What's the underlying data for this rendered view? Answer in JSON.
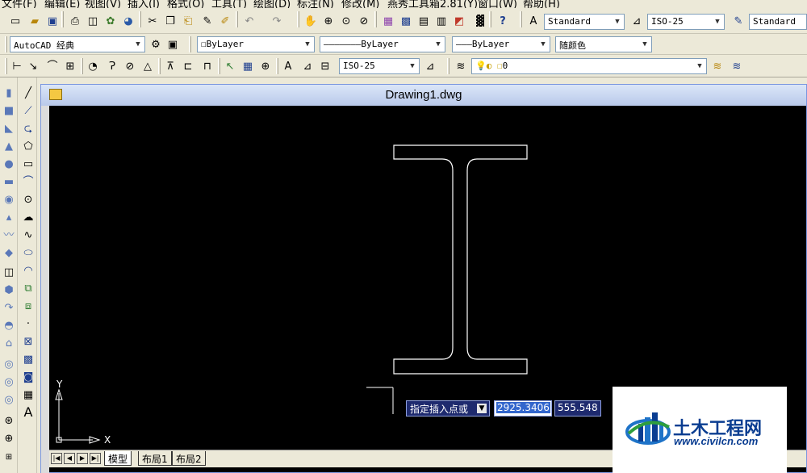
{
  "menu": [
    "文件(F)",
    "编辑(E)",
    "视图(V)",
    "插入(I)",
    "格式(O)",
    "工具(T)",
    "绘图(D)",
    "标注(N)",
    "修改(M)",
    "燕秀工具箱2.81(Y)",
    "窗口(W)",
    "帮助(H)"
  ],
  "toolbar_styles": {
    "text_style": "Standard",
    "dim_style": "ISO-25",
    "table_style": "Standard"
  },
  "layers_toolbar": {
    "workspace": "AutoCAD 经典",
    "color": "ByLayer",
    "linetype": "ByLayer",
    "lineweight": "ByLayer",
    "plot_style": "随颜色"
  },
  "dim_toolbar": {
    "dim_style": "ISO-25",
    "layer": "0"
  },
  "drawing": {
    "title": "Drawing1.dwg",
    "ucs_x": "X",
    "ucs_y": "Y"
  },
  "tabs": [
    "模型",
    "布局1",
    "布局2"
  ],
  "prompt": {
    "label": "指定插入点或",
    "x_value": "2925.3406",
    "y_value": "555.548"
  },
  "watermark": {
    "name": "土木工程网",
    "url": "www.civilcn.com"
  },
  "colors": {
    "canvas": "#000000",
    "accent": "#0a3d91",
    "prompt_bg": "#1e2a6e"
  }
}
